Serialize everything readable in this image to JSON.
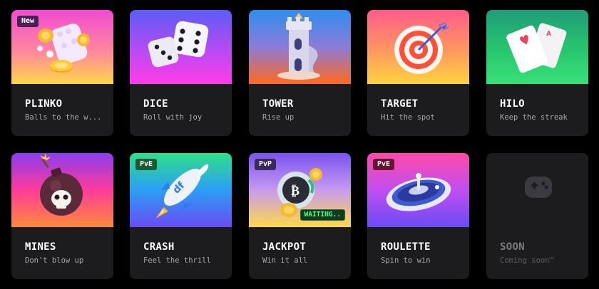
{
  "games": [
    {
      "title": "PLINKO",
      "subtitle": "Balls to the w...",
      "badge": "New"
    },
    {
      "title": "DICE",
      "subtitle": "Roll with joy"
    },
    {
      "title": "TOWER",
      "subtitle": "Rise up"
    },
    {
      "title": "TARGET",
      "subtitle": "Hit the spot"
    },
    {
      "title": "HILO",
      "subtitle": "Keep the streak"
    },
    {
      "title": "MINES",
      "subtitle": "Don't blow up"
    },
    {
      "title": "CRASH",
      "subtitle": "Feel the thrill",
      "badge": "PvE"
    },
    {
      "title": "JACKPOT",
      "subtitle": "Win it all",
      "badge": "PvP",
      "status": "WAITING.."
    },
    {
      "title": "ROULETTE",
      "subtitle": "Spin to win",
      "badge": "PvE"
    },
    {
      "title": "SOON",
      "subtitle": "Coming soon™"
    }
  ],
  "icons": {
    "plinko": "plinko-coins-icon",
    "dice": "dice-icon",
    "tower": "tower-icon",
    "target": "target-icon",
    "hilo": "playing-cards-icon",
    "mines": "bomb-icon",
    "crash": "rocket-icon",
    "jackpot": "coin-stack-icon",
    "roulette": "roulette-wheel-icon",
    "soon": "gamepad-icon"
  },
  "colors": {
    "background": "#000000",
    "card": "#1c1c1f",
    "text": "#ffffff",
    "subtext": "#a6a6ad",
    "status_green": "#4cff8a"
  }
}
